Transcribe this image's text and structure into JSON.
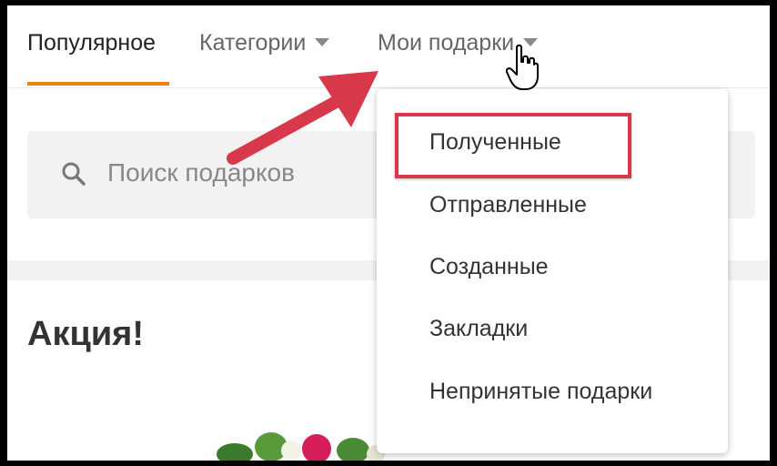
{
  "tabs": {
    "popular": "Популярное",
    "categories": "Категории",
    "my_gifts": "Мои подарки"
  },
  "search": {
    "placeholder": "Поиск подарков"
  },
  "promo": {
    "title": "Акция!"
  },
  "dropdown": {
    "items": [
      "Полученные",
      "Отправленные",
      "Созданные",
      "Закладки",
      "Непринятые подарки"
    ]
  },
  "colors": {
    "accent": "#ee8208",
    "highlight": "#d8394a"
  },
  "icons": [
    "search-icon",
    "chevron-down-icon",
    "hand-cursor-icon",
    "red-arrow-annotation"
  ]
}
